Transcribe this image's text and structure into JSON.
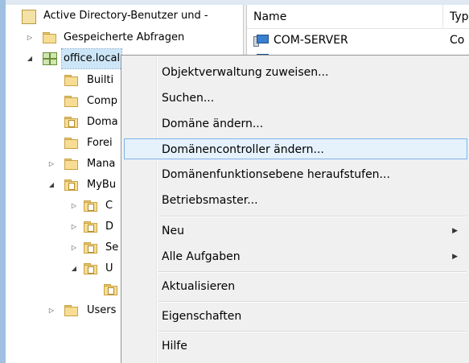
{
  "tree": {
    "root_label": "Active Directory-Benutzer und -",
    "saved_queries_label": "Gespeicherte Abfragen",
    "domain_label": "office.local",
    "children": [
      "Builti",
      "Comp",
      "Doma",
      "Forei",
      "Mana",
      "MyBu"
    ],
    "mybu_children": [
      "C",
      "D",
      "Se",
      "U"
    ],
    "users_label": "Users"
  },
  "list": {
    "columns": [
      "Name",
      "Typ"
    ],
    "rows": [
      {
        "name": "COM-SERVER",
        "type": "Co"
      }
    ]
  },
  "context_menu": {
    "items": [
      {
        "label": "Objektverwaltung zuweisen..."
      },
      {
        "label": "Suchen..."
      },
      {
        "label": "Domäne ändern..."
      },
      {
        "label": "Domänencontroller ändern..."
      },
      {
        "label": "Domänenfunktionsebene heraufstufen..."
      },
      {
        "label": "Betriebsmaster..."
      },
      {
        "label": "Neu"
      },
      {
        "label": "Alle Aufgaben"
      },
      {
        "label": "Aktualisieren"
      },
      {
        "label": "Eigenschaften"
      },
      {
        "label": "Hilfe"
      }
    ],
    "highlighted_item": "Domänencontroller ändern..."
  },
  "colors": {
    "selection": "#cde6f7",
    "menu_highlight_border": "#7eb4ea",
    "menu_background": "#f0f0f0",
    "window_border": "#9fc0e0"
  }
}
